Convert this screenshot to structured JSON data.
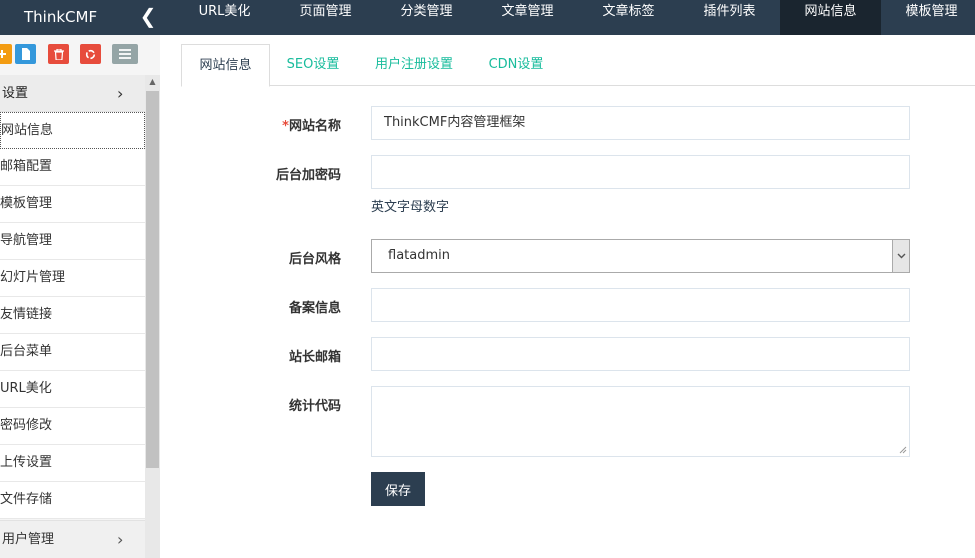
{
  "header": {
    "brand": "ThinkCMF",
    "collapse_icon": "chevron-left-icon",
    "nav": [
      "URL美化",
      "页面管理",
      "分类管理",
      "文章管理",
      "文章标签",
      "插件列表",
      "网站信息",
      "模板管理"
    ],
    "active_nav": "网站信息"
  },
  "sidebar": {
    "shortcuts": [
      {
        "icon": "plus-icon",
        "color": "#f39c12"
      },
      {
        "icon": "file-icon",
        "color": "#3498db"
      },
      {
        "icon": "trash-icon",
        "color": "#e74c3c"
      },
      {
        "icon": "recycle-icon",
        "color": "#e74c3c"
      },
      {
        "icon": "list-icon",
        "color": "#95a5a6"
      }
    ],
    "section_title": "设置",
    "items": [
      "网站信息",
      "邮箱配置",
      "模板管理",
      "导航管理",
      "幻灯片管理",
      "友情链接",
      "后台菜单",
      "URL美化",
      "密码修改",
      "上传设置",
      "文件存储"
    ],
    "active_item": "网站信息",
    "footer_section": "用户管理"
  },
  "tabs": [
    "网站信息",
    "SEO设置",
    "用户注册设置",
    "CDN设置"
  ],
  "active_tab": "网站信息",
  "form": {
    "site_name_label": "网站名称",
    "site_name_required_mark": "*",
    "site_name_value": "ThinkCMF内容管理框架",
    "admin_code_label": "后台加密码",
    "admin_code_value": "",
    "admin_code_help": "英文字母数字",
    "admin_style_label": "后台风格",
    "admin_style_value": "flatadmin",
    "icp_label": "备案信息",
    "icp_value": "",
    "webmaster_email_label": "站长邮箱",
    "webmaster_email_value": "",
    "stat_code_label": "统计代码",
    "stat_code_value": "",
    "save_label": "保存"
  },
  "colors": {
    "topbar": "#2c3e50",
    "topbar_active": "#1a252f",
    "tab_link": "#18bc9c",
    "primary_button": "#2c3e50"
  }
}
